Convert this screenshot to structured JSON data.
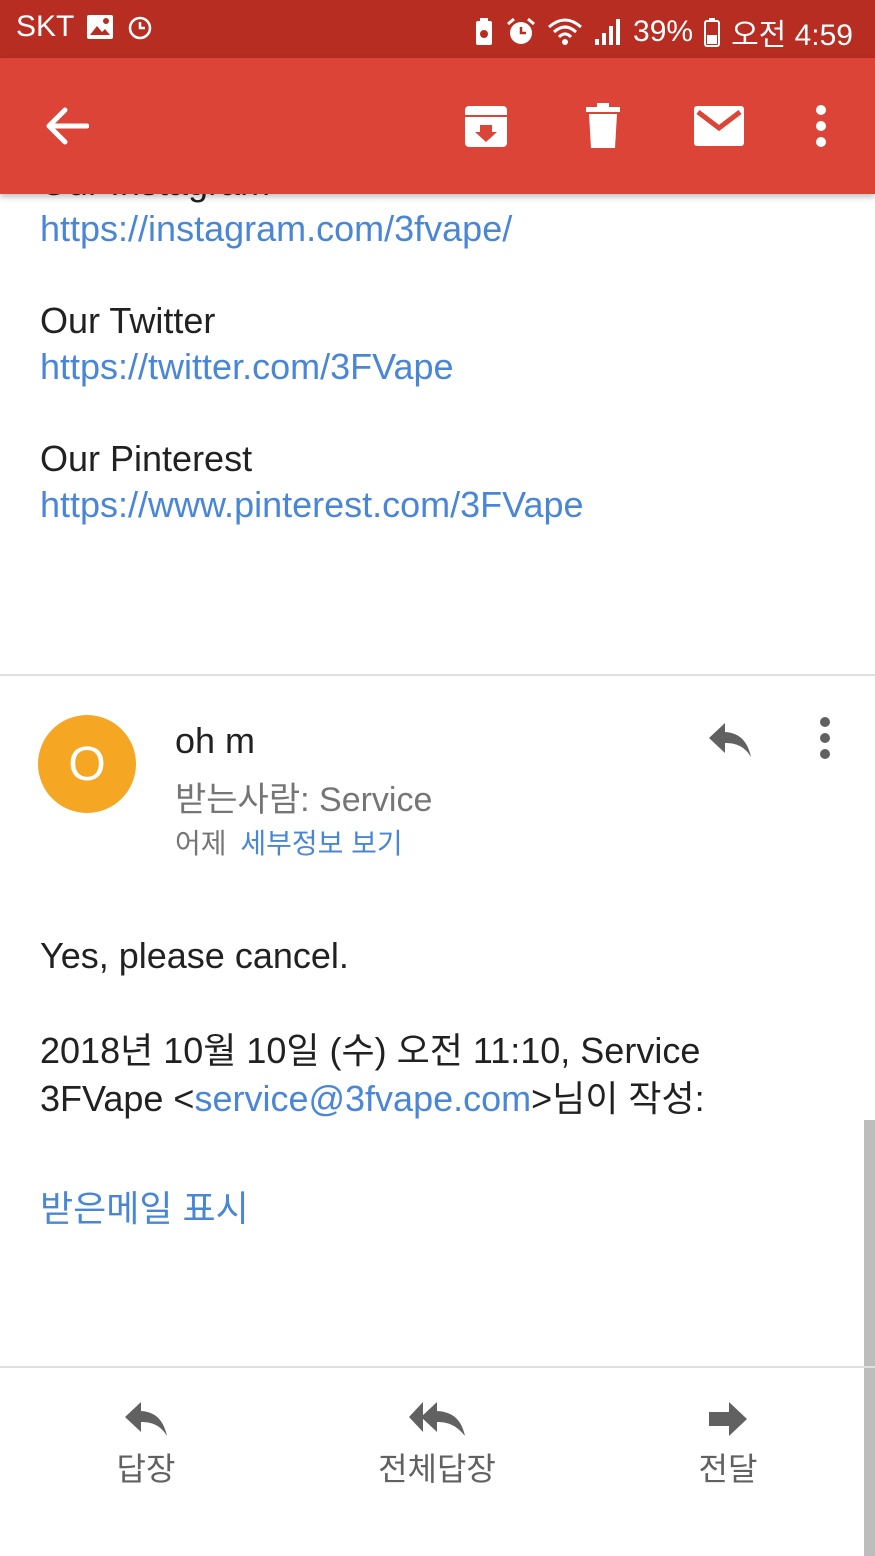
{
  "status_bar": {
    "carrier": "SKT",
    "battery": "39%",
    "time": "오전 4:59",
    "icons": [
      "image-icon",
      "alarm-icon",
      "battery-saver-icon",
      "alarm-clock-icon",
      "wifi-icon",
      "signal-icon",
      "battery-icon"
    ]
  },
  "app_bar": {
    "icons": [
      "back-arrow-icon",
      "archive-icon",
      "delete-icon",
      "mail-icon",
      "more-vert-icon"
    ],
    "color": "#db4437"
  },
  "previous_message": {
    "instagram_label": "Our Instagram",
    "instagram_url": "https://instagram.com/3fvape/",
    "twitter_label": "Our Twitter",
    "twitter_url": "https://twitter.com/3FVape",
    "pinterest_label": "Our Pinterest",
    "pinterest_url": "https://www.pinterest.com/3FVape"
  },
  "message": {
    "avatar_letter": "O",
    "avatar_color": "#f5a623",
    "sender": "oh m",
    "recipient": "받는사람: Service",
    "date": "어제",
    "details_link": "세부정보 보기",
    "body": "Yes, please cancel.",
    "quote_prefix": "2018년 10월 10일 (수) 오전 11:10, Service 3FVape <",
    "quote_email": "service@3fvape.com",
    "quote_suffix": ">님이 작성:",
    "show_quoted": "받은메일 표시"
  },
  "bottom_actions": {
    "reply": "답장",
    "reply_all": "전체답장",
    "forward": "전달"
  },
  "colors": {
    "link": "#4a86d6",
    "status_bar": "#b72d22"
  }
}
